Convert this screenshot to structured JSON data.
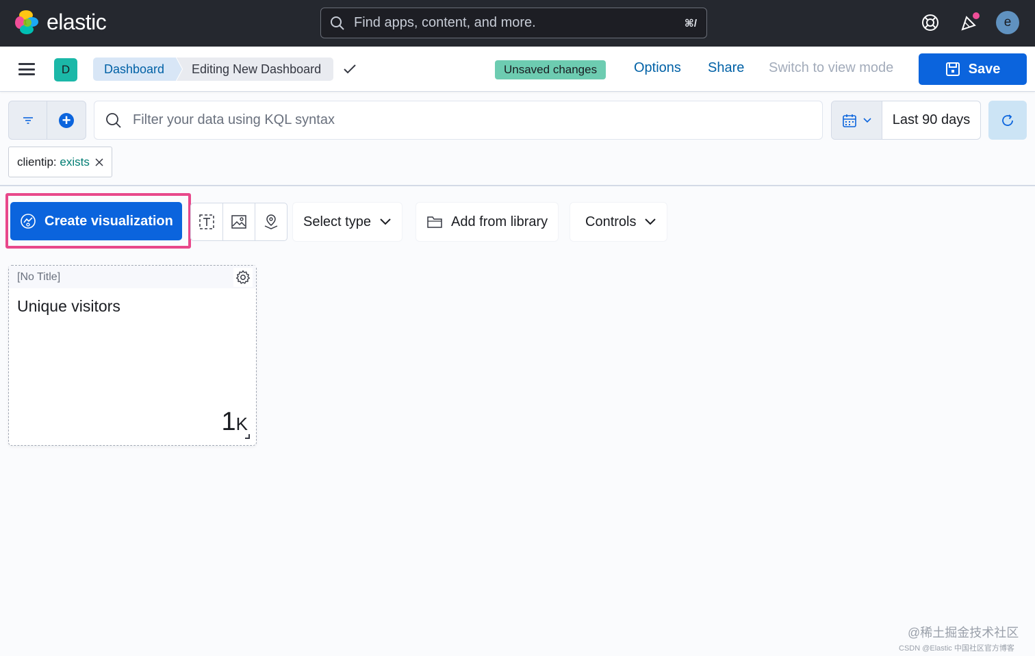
{
  "header": {
    "brand": "elastic",
    "search_placeholder": "Find apps, content, and more.",
    "search_shortcut": "⌘/",
    "user_initial": "e"
  },
  "appbar": {
    "space_initial": "D",
    "breadcrumbs": [
      "Dashboard",
      "Editing New Dashboard"
    ],
    "status_badge": "Unsaved changes",
    "links": {
      "options": "Options",
      "share": "Share",
      "switch_mode": "Switch to view mode"
    },
    "save_label": "Save"
  },
  "query_bar": {
    "placeholder": "Filter your data using KQL syntax",
    "time_range": "Last 90 days"
  },
  "filters": [
    {
      "field": "clientip:",
      "operator": "exists"
    }
  ],
  "toolbar": {
    "create_label": "Create visualization",
    "select_type_label": "Select type",
    "add_from_library_label": "Add from library",
    "controls_label": "Controls"
  },
  "panels": [
    {
      "title": "[No Title]",
      "metric_label": "Unique visitors",
      "metric_value": "1",
      "metric_suffix": "K"
    }
  ],
  "watermark": {
    "line1": "@稀土掘金技术社区",
    "line2": "CSDN @Elastic 中国社区官方博客"
  },
  "colors": {
    "primary": "#0b64dd",
    "highlight": "#e8488b",
    "unsaved_badge": "#6dccb1",
    "header_bg": "#25282f"
  }
}
